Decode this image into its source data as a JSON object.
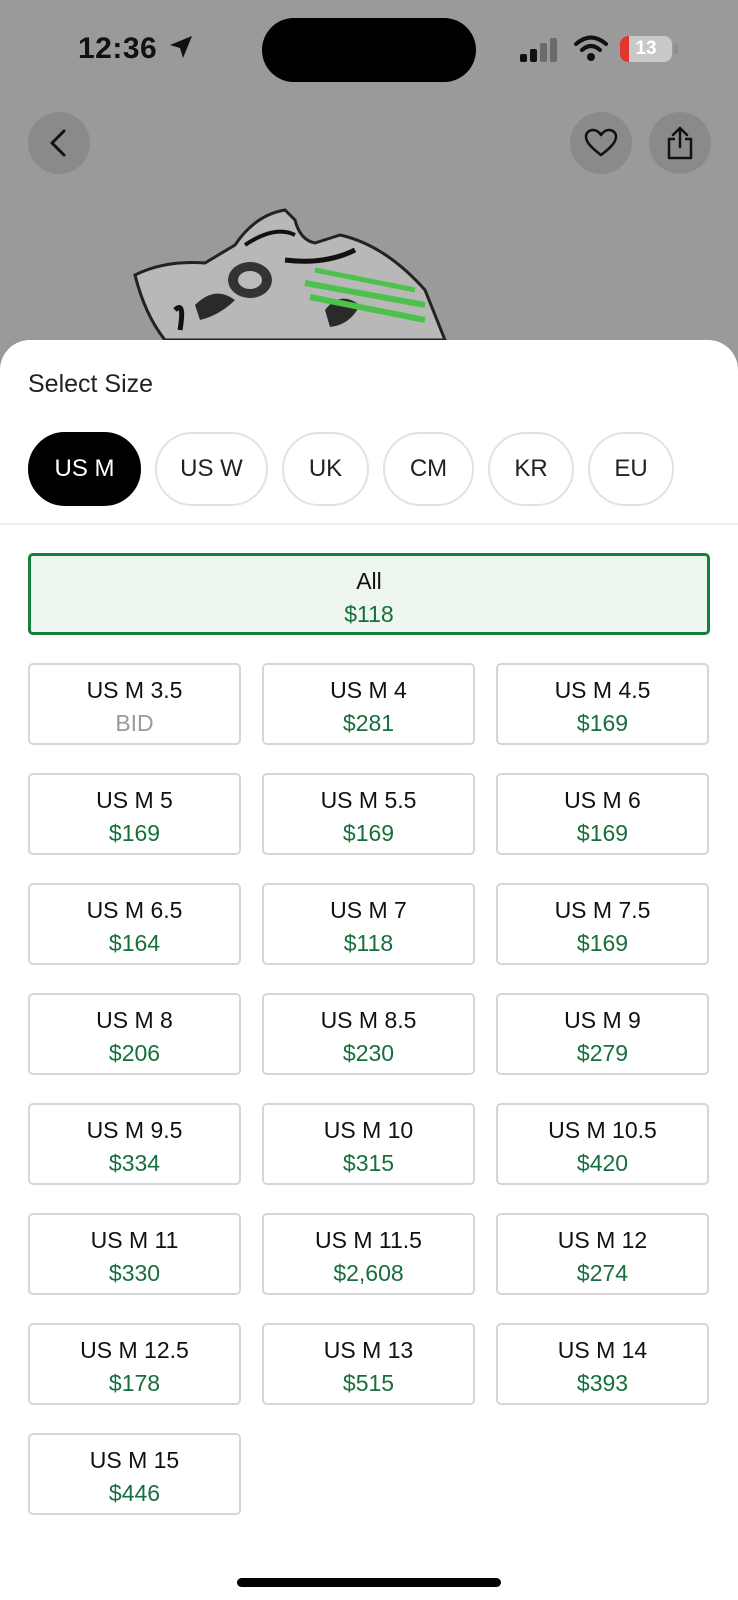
{
  "status_bar": {
    "time": "12:36",
    "battery": "13"
  },
  "header": {
    "back_icon": "chevron-left-icon",
    "favorite_icon": "heart-icon",
    "share_icon": "share-icon"
  },
  "size_sheet": {
    "title": "Select Size",
    "unit_tabs": [
      {
        "label": "US M",
        "selected": true
      },
      {
        "label": "US W",
        "selected": false
      },
      {
        "label": "UK",
        "selected": false
      },
      {
        "label": "CM",
        "selected": false
      },
      {
        "label": "KR",
        "selected": false
      },
      {
        "label": "EU",
        "selected": false
      }
    ],
    "all_option": {
      "label": "All",
      "price": "$118",
      "selected": true
    },
    "sizes": [
      {
        "label": "US M 3.5",
        "price": "BID"
      },
      {
        "label": "US M 4",
        "price": "$281"
      },
      {
        "label": "US M 4.5",
        "price": "$169"
      },
      {
        "label": "US M 5",
        "price": "$169"
      },
      {
        "label": "US M 5.5",
        "price": "$169"
      },
      {
        "label": "US M 6",
        "price": "$169"
      },
      {
        "label": "US M 6.5",
        "price": "$164"
      },
      {
        "label": "US M 7",
        "price": "$118"
      },
      {
        "label": "US M 7.5",
        "price": "$169"
      },
      {
        "label": "US M 8",
        "price": "$206"
      },
      {
        "label": "US M 8.5",
        "price": "$230"
      },
      {
        "label": "US M 9",
        "price": "$279"
      },
      {
        "label": "US M 9.5",
        "price": "$334"
      },
      {
        "label": "US M 10",
        "price": "$315"
      },
      {
        "label": "US M 10.5",
        "price": "$420"
      },
      {
        "label": "US M 11",
        "price": "$330"
      },
      {
        "label": "US M 11.5",
        "price": "$2,608"
      },
      {
        "label": "US M 12",
        "price": "$274"
      },
      {
        "label": "US M 12.5",
        "price": "$178"
      },
      {
        "label": "US M 13",
        "price": "$515"
      },
      {
        "label": "US M 14",
        "price": "$393"
      },
      {
        "label": "US M 15",
        "price": "$446"
      }
    ]
  },
  "colors": {
    "price_green": "#176f3d",
    "selected_border": "#14803a",
    "selected_fill": "#edf7ef",
    "bid_gray": "#9b9b9b",
    "active_tab": "#000000"
  }
}
